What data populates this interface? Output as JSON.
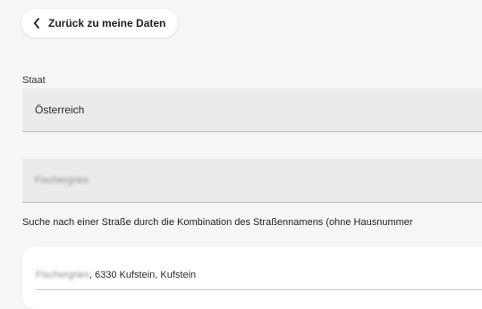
{
  "back_button": {
    "label": "Zurück zu meine Daten",
    "icon": "chevron-left-icon"
  },
  "country": {
    "label": "Staat",
    "value": "Österreich"
  },
  "street": {
    "value": "Fischergries"
  },
  "hint": "Suche nach einer Straße durch die Kombination des Straßennamens (ohne Hausnummer",
  "suggestion": {
    "street": "Fischergries",
    "rest": ", 6330 Kufstein, Kufstein"
  }
}
